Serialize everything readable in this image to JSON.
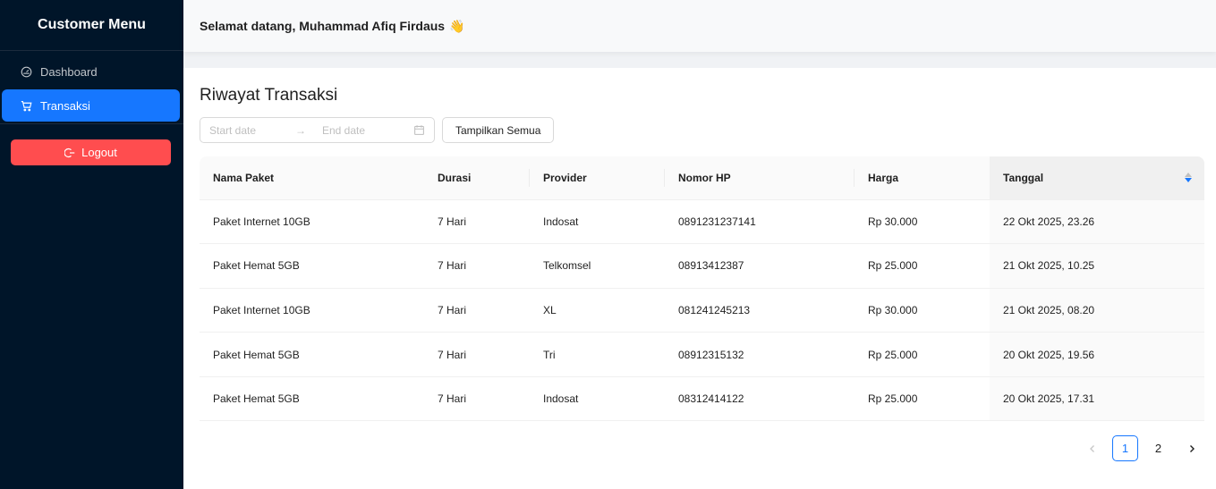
{
  "sidebar": {
    "title": "Customer Menu",
    "items": [
      {
        "label": "Dashboard",
        "icon": "dashboard-icon"
      },
      {
        "label": "Transaksi",
        "icon": "cart-icon"
      }
    ],
    "logout_label": "Logout"
  },
  "header": {
    "greeting": "Selamat datang, Muhammad Afiq Firdaus",
    "emoji": "👋"
  },
  "main": {
    "title": "Riwayat Transaksi",
    "start_placeholder": "Start date",
    "end_placeholder": "End date",
    "show_all_label": "Tampilkan Semua"
  },
  "table": {
    "columns": [
      "Nama Paket",
      "Durasi",
      "Provider",
      "Nomor HP",
      "Harga",
      "Tanggal"
    ],
    "rows": [
      [
        "Paket Internet 10GB",
        "7 Hari",
        "Indosat",
        "0891231237141",
        "Rp 30.000",
        "22 Okt 2025, 23.26"
      ],
      [
        "Paket Hemat 5GB",
        "7 Hari",
        "Telkomsel",
        "08913412387",
        "Rp 25.000",
        "21 Okt 2025, 10.25"
      ],
      [
        "Paket Internet 10GB",
        "7 Hari",
        "XL",
        "081241245213",
        "Rp 30.000",
        "21 Okt 2025, 08.20"
      ],
      [
        "Paket Hemat 5GB",
        "7 Hari",
        "Tri",
        "08912315132",
        "Rp 25.000",
        "20 Okt 2025, 19.56"
      ],
      [
        "Paket Hemat 5GB",
        "7 Hari",
        "Indosat",
        "08312414122",
        "Rp 25.000",
        "20 Okt 2025, 17.31"
      ]
    ]
  },
  "pagination": {
    "pages": [
      "1",
      "2"
    ],
    "current": "1"
  },
  "colors": {
    "sidebar_bg": "#001529",
    "accent": "#1677ff",
    "logout": "#ff4d4f"
  }
}
